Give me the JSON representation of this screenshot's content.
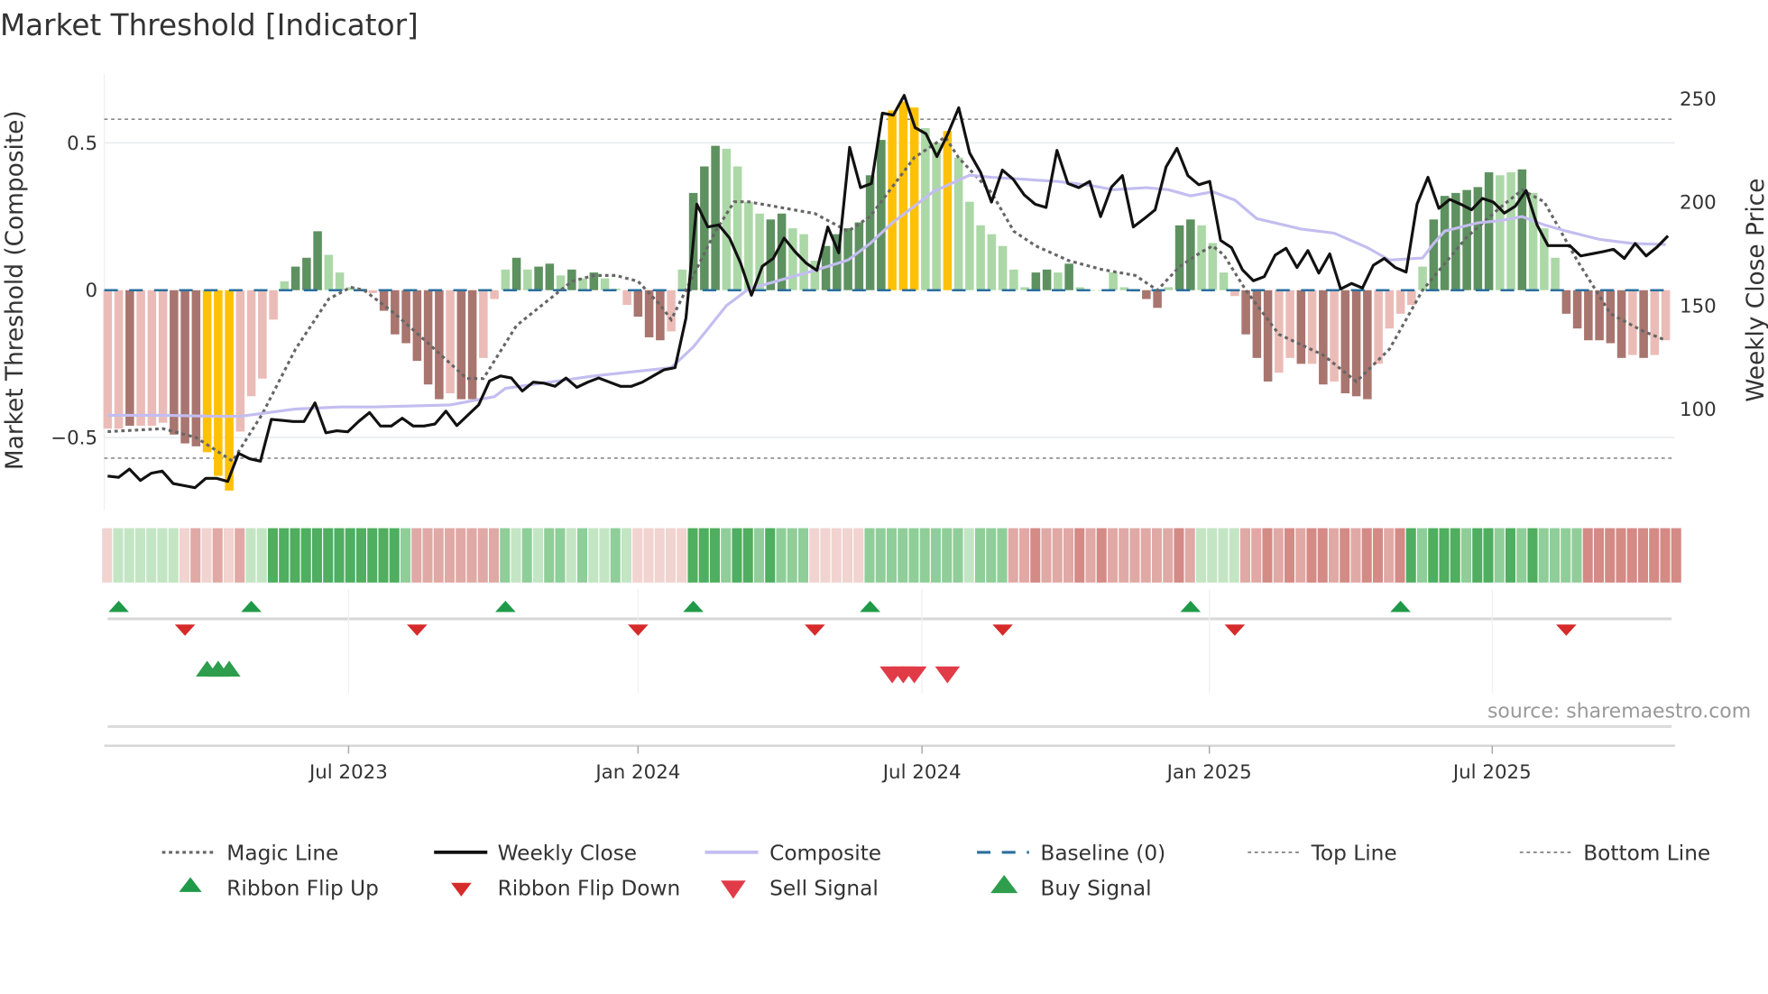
{
  "chart_data": {
    "type": "bar",
    "title": "Market Threshold [Indicator]",
    "ylabel_left": "Market Threshold (Composite)",
    "ylabel_right": "Weekly Close Price",
    "x_unit": "week index (weekly, ~Feb 2023 to Nov 2025)",
    "ylim_left": [
      -0.75,
      0.75
    ],
    "ylim_right": [
      50,
      260
    ],
    "left_ticks": [
      {
        "v": 0.5,
        "label": "0.5"
      },
      {
        "v": 0,
        "label": "0"
      },
      {
        "v": -0.5,
        "label": "−0.5"
      }
    ],
    "right_ticks": [
      {
        "v": 250,
        "label": "250"
      },
      {
        "v": 200,
        "label": "200"
      },
      {
        "v": 150,
        "label": "150"
      },
      {
        "v": 100,
        "label": "100"
      }
    ],
    "x_ticks": [
      {
        "week": 21.8,
        "label": "Jul 2023"
      },
      {
        "week": 48,
        "label": "Jan 2024"
      },
      {
        "week": 73.7,
        "label": "Jul 2024"
      },
      {
        "week": 99.7,
        "label": "Jan 2025"
      },
      {
        "week": 125.3,
        "label": "Jul 2025"
      }
    ],
    "top_line": 0.58,
    "bottom_line": -0.57,
    "colors": {
      "lr": "#ebbcb7",
      "dr": "#a9756f",
      "y": "#ffc107",
      "lg": "#acd8a7",
      "dg": "#5e9160",
      "magic": "#666666",
      "close": "#111111",
      "composite": "#c3bdf0",
      "baseline": "#2b6f9e"
    },
    "histogram": [
      [
        -0.47,
        "lr"
      ],
      [
        -0.47,
        "lr"
      ],
      [
        -0.46,
        "dr"
      ],
      [
        -0.46,
        "lr"
      ],
      [
        -0.46,
        "lr"
      ],
      [
        -0.45,
        "lr"
      ],
      [
        -0.49,
        "dr"
      ],
      [
        -0.52,
        "dr"
      ],
      [
        -0.53,
        "dr"
      ],
      [
        -0.55,
        "y"
      ],
      [
        -0.63,
        "y"
      ],
      [
        -0.68,
        "y"
      ],
      [
        -0.48,
        "lr"
      ],
      [
        -0.36,
        "lr"
      ],
      [
        -0.3,
        "lr"
      ],
      [
        -0.1,
        "lr"
      ],
      [
        0.03,
        "lg"
      ],
      [
        0.08,
        "dg"
      ],
      [
        0.11,
        "dg"
      ],
      [
        0.2,
        "dg"
      ],
      [
        0.12,
        "lg"
      ],
      [
        0.06,
        "lg"
      ],
      [
        0.01,
        "lg"
      ],
      [
        0.005,
        "lg"
      ],
      [
        -0.01,
        "lr"
      ],
      [
        -0.07,
        "dr"
      ],
      [
        -0.15,
        "dr"
      ],
      [
        -0.18,
        "dr"
      ],
      [
        -0.24,
        "dr"
      ],
      [
        -0.32,
        "dr"
      ],
      [
        -0.37,
        "dr"
      ],
      [
        -0.35,
        "lr"
      ],
      [
        -0.37,
        "dr"
      ],
      [
        -0.37,
        "dr"
      ],
      [
        -0.23,
        "lr"
      ],
      [
        -0.03,
        "lr"
      ],
      [
        0.07,
        "lg"
      ],
      [
        0.11,
        "dg"
      ],
      [
        0.07,
        "lg"
      ],
      [
        0.08,
        "dg"
      ],
      [
        0.09,
        "dg"
      ],
      [
        0.05,
        "lg"
      ],
      [
        0.07,
        "dg"
      ],
      [
        0.04,
        "lg"
      ],
      [
        0.06,
        "dg"
      ],
      [
        0.04,
        "lg"
      ],
      [
        0.005,
        "lg"
      ],
      [
        -0.05,
        "lr"
      ],
      [
        -0.09,
        "dr"
      ],
      [
        -0.16,
        "dr"
      ],
      [
        -0.17,
        "dr"
      ],
      [
        -0.14,
        "lr"
      ],
      [
        0.07,
        "lg"
      ],
      [
        0.33,
        "dg"
      ],
      [
        0.42,
        "dg"
      ],
      [
        0.49,
        "dg"
      ],
      [
        0.48,
        "lg"
      ],
      [
        0.42,
        "lg"
      ],
      [
        0.3,
        "lg"
      ],
      [
        0.26,
        "lg"
      ],
      [
        0.24,
        "dg"
      ],
      [
        0.26,
        "dg"
      ],
      [
        0.21,
        "lg"
      ],
      [
        0.19,
        "lg"
      ],
      [
        0.1,
        "lg"
      ],
      [
        0.15,
        "dg"
      ],
      [
        0.19,
        "dg"
      ],
      [
        0.21,
        "dg"
      ],
      [
        0.23,
        "dg"
      ],
      [
        0.39,
        "dg"
      ],
      [
        0.51,
        "dg"
      ],
      [
        0.61,
        "y"
      ],
      [
        0.64,
        "y"
      ],
      [
        0.62,
        "y"
      ],
      [
        0.55,
        "lg"
      ],
      [
        0.5,
        "lg"
      ],
      [
        0.54,
        "y"
      ],
      [
        0.45,
        "lg"
      ],
      [
        0.3,
        "lg"
      ],
      [
        0.22,
        "lg"
      ],
      [
        0.19,
        "lg"
      ],
      [
        0.15,
        "lg"
      ],
      [
        0.07,
        "lg"
      ],
      [
        0.01,
        "lg"
      ],
      [
        0.06,
        "dg"
      ],
      [
        0.07,
        "dg"
      ],
      [
        0.06,
        "lg"
      ],
      [
        0.09,
        "dg"
      ],
      [
        0.01,
        "lg"
      ],
      [
        0.0,
        "lg"
      ],
      [
        0.0,
        "lg"
      ],
      [
        0.06,
        "lg"
      ],
      [
        0.01,
        "lg"
      ],
      [
        -0.005,
        "lr"
      ],
      [
        -0.03,
        "dr"
      ],
      [
        -0.06,
        "dr"
      ],
      [
        0.01,
        "lg"
      ],
      [
        0.22,
        "dg"
      ],
      [
        0.24,
        "dg"
      ],
      [
        0.22,
        "lg"
      ],
      [
        0.16,
        "lg"
      ],
      [
        0.06,
        "lg"
      ],
      [
        -0.02,
        "lr"
      ],
      [
        -0.15,
        "dr"
      ],
      [
        -0.23,
        "dr"
      ],
      [
        -0.31,
        "dr"
      ],
      [
        -0.28,
        "lr"
      ],
      [
        -0.23,
        "lr"
      ],
      [
        -0.25,
        "dr"
      ],
      [
        -0.25,
        "lr"
      ],
      [
        -0.32,
        "dr"
      ],
      [
        -0.31,
        "lr"
      ],
      [
        -0.35,
        "dr"
      ],
      [
        -0.36,
        "dr"
      ],
      [
        -0.37,
        "dr"
      ],
      [
        -0.25,
        "lr"
      ],
      [
        -0.13,
        "lr"
      ],
      [
        -0.08,
        "lr"
      ],
      [
        -0.05,
        "lr"
      ],
      [
        0.08,
        "lg"
      ],
      [
        0.24,
        "dg"
      ],
      [
        0.32,
        "dg"
      ],
      [
        0.33,
        "dg"
      ],
      [
        0.34,
        "dg"
      ],
      [
        0.35,
        "dg"
      ],
      [
        0.4,
        "dg"
      ],
      [
        0.39,
        "lg"
      ],
      [
        0.4,
        "lg"
      ],
      [
        0.41,
        "dg"
      ],
      [
        0.33,
        "lg"
      ],
      [
        0.21,
        "lg"
      ],
      [
        0.11,
        "lg"
      ],
      [
        -0.08,
        "dr"
      ],
      [
        -0.13,
        "dr"
      ],
      [
        -0.17,
        "dr"
      ],
      [
        -0.17,
        "dr"
      ],
      [
        -0.18,
        "dr"
      ],
      [
        -0.23,
        "dr"
      ],
      [
        -0.22,
        "lr"
      ],
      [
        -0.23,
        "dr"
      ],
      [
        -0.22,
        "lr"
      ],
      [
        -0.17,
        "lr"
      ]
    ],
    "weekly_close": [
      67.6,
      67,
      71,
      65.5,
      69,
      70,
      64,
      63,
      62,
      66.5,
      66.5,
      65,
      78.6,
      76,
      74.8,
      95,
      94.5,
      94,
      94,
      103,
      88.5,
      89.5,
      89,
      94,
      98.3,
      91.8,
      91.8,
      95.6,
      91.8,
      91.8,
      92.8,
      99,
      92,
      97,
      102,
      113.6,
      116,
      115,
      108.7,
      113,
      112.5,
      111,
      115,
      110.5,
      113,
      115,
      113,
      111,
      111,
      113,
      116,
      119,
      120,
      144,
      199,
      188,
      189,
      182.6,
      170.6,
      155,
      169,
      172.8,
      182.6,
      176,
      170.6,
      167,
      188,
      175.5,
      226.5,
      207,
      209,
      243,
      242,
      251.6,
      236,
      233,
      222,
      233,
      245.6,
      223.7,
      214.4,
      200,
      215.5,
      211,
      203.5,
      199,
      197.4,
      225,
      209,
      207,
      210,
      193,
      207.3,
      212.8,
      188,
      192,
      196.3,
      217,
      226,
      212.8,
      208.4,
      210,
      181.5,
      178,
      167.3,
      162,
      164,
      174.4,
      177.7,
      168.4,
      176.6,
      165.7,
      175,
      158,
      160.7,
      158.5,
      169.5,
      172.8,
      168.4,
      166.2,
      199,
      212,
      197,
      201.3,
      199,
      196.3,
      201.8,
      200,
      194.7,
      198,
      205.6,
      189,
      179,
      179,
      179,
      174,
      175,
      176,
      177.2,
      172.8,
      180,
      174,
      178.3,
      183.7
    ],
    "magic_line": [
      [
        0,
        -0.48
      ],
      [
        5,
        -0.47
      ],
      [
        8,
        -0.5
      ],
      [
        11.3,
        -0.58
      ],
      [
        14,
        -0.42
      ],
      [
        17,
        -0.2
      ],
      [
        20,
        -0.03
      ],
      [
        22,
        0.01
      ],
      [
        23.2,
        0.0
      ],
      [
        26,
        -0.08
      ],
      [
        29,
        -0.18
      ],
      [
        32.5,
        -0.3
      ],
      [
        34,
        -0.3
      ],
      [
        37,
        -0.12
      ],
      [
        40,
        -0.03
      ],
      [
        42,
        0.03
      ],
      [
        44,
        0.05
      ],
      [
        46,
        0.05
      ],
      [
        48,
        0.03
      ],
      [
        50,
        -0.05
      ],
      [
        51,
        -0.1
      ],
      [
        53,
        0.05
      ],
      [
        55,
        0.2
      ],
      [
        56.7,
        0.3
      ],
      [
        58,
        0.3
      ],
      [
        61,
        0.28
      ],
      [
        64,
        0.26
      ],
      [
        66,
        0.22
      ],
      [
        67,
        0.2
      ],
      [
        69,
        0.25
      ],
      [
        71,
        0.35
      ],
      [
        73,
        0.45
      ],
      [
        75.8,
        0.52
      ],
      [
        77,
        0.45
      ],
      [
        80,
        0.33
      ],
      [
        82,
        0.2
      ],
      [
        84,
        0.15
      ],
      [
        87,
        0.1
      ],
      [
        90,
        0.07
      ],
      [
        93,
        0.05
      ],
      [
        95,
        0.0
      ],
      [
        97,
        0.08
      ],
      [
        99,
        0.13
      ],
      [
        100,
        0.15
      ],
      [
        101,
        0.12
      ],
      [
        103,
        0.0
      ],
      [
        106,
        -0.15
      ],
      [
        110,
        -0.22
      ],
      [
        113,
        -0.31
      ],
      [
        116,
        -0.2
      ],
      [
        119,
        0.0
      ],
      [
        123,
        0.18
      ],
      [
        126,
        0.28
      ],
      [
        128,
        0.34
      ],
      [
        130,
        0.3
      ],
      [
        133,
        0.1
      ],
      [
        136,
        -0.08
      ],
      [
        139,
        -0.14
      ],
      [
        141,
        -0.17
      ]
    ],
    "composite_line": [
      [
        0,
        97
      ],
      [
        5,
        97
      ],
      [
        10,
        96.5
      ],
      [
        12,
        96.5
      ],
      [
        17,
        100
      ],
      [
        21,
        101
      ],
      [
        24,
        101
      ],
      [
        31,
        102
      ],
      [
        35,
        106
      ],
      [
        36,
        110
      ],
      [
        44,
        116
      ],
      [
        51,
        120
      ],
      [
        53,
        130
      ],
      [
        56,
        150
      ],
      [
        58,
        158
      ],
      [
        64,
        167
      ],
      [
        67,
        172
      ],
      [
        69,
        180
      ],
      [
        71,
        190
      ],
      [
        73,
        198
      ],
      [
        74.7,
        205
      ],
      [
        78,
        213
      ],
      [
        80,
        212
      ],
      [
        83,
        211
      ],
      [
        86,
        210
      ],
      [
        89,
        208
      ],
      [
        91,
        206
      ],
      [
        94,
        207
      ],
      [
        96,
        206
      ],
      [
        98,
        203
      ],
      [
        100,
        205
      ],
      [
        102,
        201
      ],
      [
        104,
        192
      ],
      [
        108,
        187
      ],
      [
        111,
        185
      ],
      [
        114,
        178
      ],
      [
        116,
        172
      ],
      [
        119,
        173
      ],
      [
        120,
        180
      ],
      [
        121,
        186
      ],
      [
        124,
        190
      ],
      [
        126,
        191
      ],
      [
        128,
        193
      ],
      [
        130,
        189
      ],
      [
        132,
        186
      ],
      [
        135,
        182
      ],
      [
        138,
        180
      ],
      [
        141,
        179.5
      ]
    ],
    "ribbon": [
      -1,
      1,
      1,
      1,
      1,
      1,
      1,
      -1,
      -2,
      -1,
      -2,
      -1,
      -2,
      1,
      1,
      3,
      3,
      3,
      3,
      3,
      3,
      3,
      3,
      3,
      3,
      3,
      3,
      2,
      -2,
      -2,
      -2,
      -2,
      -2,
      -2,
      -2,
      -2,
      2,
      1,
      2,
      1,
      2,
      2,
      1,
      2,
      1,
      1,
      2,
      1,
      -1,
      -1,
      -1,
      -1,
      -1,
      3,
      3,
      3,
      2,
      3,
      3,
      2,
      3,
      2,
      2,
      2,
      -1,
      -1,
      -1,
      -1,
      -1,
      2,
      2,
      2,
      2,
      2,
      2,
      2,
      2,
      2,
      1,
      2,
      2,
      2,
      -2,
      -2,
      -3,
      -2,
      -2,
      -2,
      -3,
      -2,
      -3,
      -2,
      -2,
      -2,
      -2,
      -2,
      -2,
      -3,
      -2,
      1,
      1,
      1,
      1,
      -2,
      -2,
      -3,
      -2,
      -3,
      -2,
      -3,
      -3,
      -2,
      -3,
      -2,
      -3,
      -3,
      -2,
      -3,
      3,
      2,
      3,
      3,
      3,
      2,
      3,
      3,
      2,
      3,
      2,
      3,
      2,
      2,
      2,
      2,
      -3,
      -3,
      -3,
      -3,
      -3,
      -3,
      -3,
      -3,
      -3
    ],
    "ribbon_flip_up_weeks": [
      1,
      13,
      36,
      53,
      69,
      98,
      117
    ],
    "ribbon_flip_down_weeks": [
      7,
      28,
      48,
      64,
      81,
      102,
      132
    ],
    "buy_signal_weeks": [
      9,
      10,
      11
    ],
    "sell_signal_weeks": [
      71,
      72,
      73,
      76
    ],
    "legend": {
      "magic": "Magic Line",
      "close": "Weekly Close",
      "composite": "Composite",
      "baseline": "Baseline (0)",
      "top": "Top Line",
      "bottom": "Bottom Line",
      "flip_up": "Ribbon Flip Up",
      "flip_down": "Ribbon Flip Down",
      "sell": "Sell Signal",
      "buy": "Buy Signal"
    },
    "legend_position": "bottom",
    "source": "source: sharemaestro.com"
  }
}
